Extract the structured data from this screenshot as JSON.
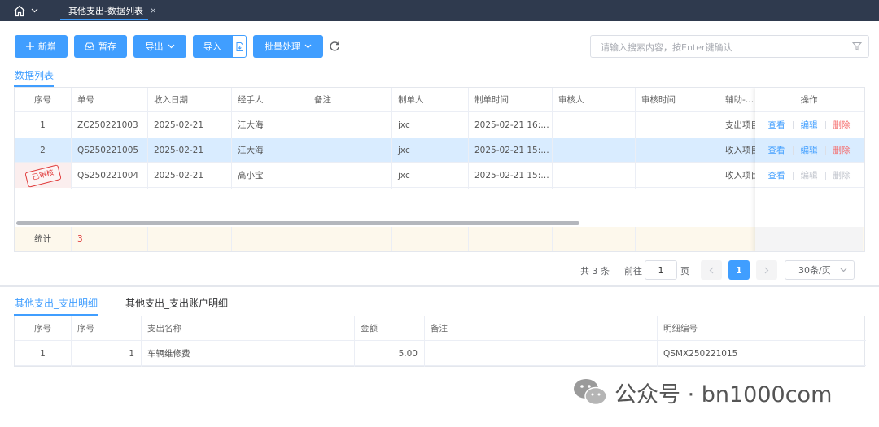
{
  "window": {
    "active_tab": "其他支出-数据列表",
    "tab_close": "×"
  },
  "toolbar": {
    "add": "新增",
    "save_draft": "暂存",
    "export": "导出",
    "import": "导入",
    "batch": "批量处理",
    "search_placeholder": "请输入搜索内容，按Enter键确认"
  },
  "section_tab": "数据列表",
  "main_table": {
    "columns": [
      "序号",
      "单号",
      "收入日期",
      "经手人",
      "备注",
      "制单人",
      "制单时间",
      "审核人",
      "审核时间",
      "辅助-收入",
      "操作"
    ],
    "rows": [
      {
        "index": "1",
        "no": "ZC250221003",
        "date": "2025-02-21",
        "handler": "江大海",
        "remark": "",
        "maker": "jxc",
        "make_time": "2025-02-21 16:…",
        "auditor": "",
        "audit_time": "",
        "aux": "支出项目",
        "stamp": ""
      },
      {
        "index": "2",
        "no": "QS250221005",
        "date": "2025-02-21",
        "handler": "江大海",
        "remark": "",
        "maker": "jxc",
        "make_time": "2025-02-21 15:…",
        "auditor": "",
        "audit_time": "",
        "aux": "收入项目",
        "stamp": ""
      },
      {
        "index": "",
        "no": "QS250221004",
        "date": "2025-02-21",
        "handler": "高小宝",
        "remark": "",
        "maker": "jxc",
        "make_time": "2025-02-21 15:…",
        "auditor": "",
        "audit_time": "",
        "aux": "收入项目",
        "stamp": "已审核"
      }
    ],
    "actions": {
      "view": "查看",
      "edit": "编辑",
      "delete": "删除"
    },
    "summary_label": "统计",
    "summary_count": "3",
    "selected_row": 2
  },
  "pagination": {
    "total": "共 3 条",
    "goto_prefix": "前往",
    "goto_value": "1",
    "goto_suffix": "页",
    "current_page": "1",
    "page_size": "30条/页"
  },
  "detail_tabs": [
    "其他支出_支出明细",
    "其他支出_支出账户明细"
  ],
  "detail_table": {
    "columns": [
      "序号",
      "序号",
      "支出名称",
      "金额",
      "备注",
      "明细编号"
    ],
    "rows": [
      {
        "index": "1",
        "seq": "1",
        "name": "车辆维修费",
        "amount": "5.00",
        "remark": "",
        "code": "QSMX250221015"
      }
    ]
  },
  "watermark": "公众号 · bn1000com",
  "colors": {
    "primary": "#409eff",
    "topbar": "#2f3a4e",
    "danger": "#f56c6c",
    "selected_row": "#d9ecff",
    "stamp": "#e03b3b"
  }
}
